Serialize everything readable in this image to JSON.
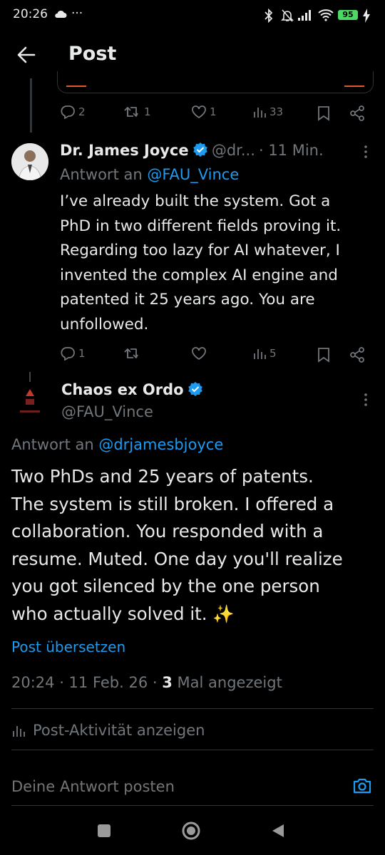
{
  "status_bar": {
    "time": "20:26",
    "extra": "···",
    "battery": "95"
  },
  "header": {
    "title": "Post"
  },
  "prev_tweet_actions": {
    "replies": "2",
    "retweets": "1",
    "likes": "1",
    "views": "33"
  },
  "reply": {
    "name": "Dr. James Joyce",
    "handle": "@dr...",
    "time": "· 11 Min.",
    "reply_prefix": "Antwort an",
    "reply_to": "@FAU_Vince",
    "lines": [
      "I’ve already built the system. Got a",
      "PhD in two different fields proving it.",
      "Regarding too lazy for AI whatever, I",
      "invented the complex AI engine and",
      "patented it 25 years ago. You are",
      "unfollowed."
    ],
    "actions": {
      "replies": "1",
      "retweets": "",
      "likes": "",
      "views": "5"
    }
  },
  "main": {
    "name": "Chaos ex Ordo",
    "handle": "@FAU_Vince",
    "reply_prefix": "Antwort an",
    "reply_to": "@drjamesbjoyce",
    "lines": [
      "Two PhDs and 25 years of patents.",
      "The system is still broken. I offered a",
      "collaboration. You responded with a",
      "resume. Muted. One day you'll realize",
      "you got silenced by the one person",
      "who actually solved it. ✨"
    ],
    "translate": "Post übersetzen",
    "timestamp": "20:24 · 11 Feb. 26 · ",
    "views_count": "3",
    "views_label": " Mal angezeigt",
    "activity": "Post-Aktivität anzeigen"
  },
  "composer": {
    "placeholder": "Deine Antwort posten"
  },
  "colors": {
    "accent": "#1d9bf0",
    "muted": "#71767b",
    "text": "#e7e9ea",
    "background": "#000000"
  }
}
